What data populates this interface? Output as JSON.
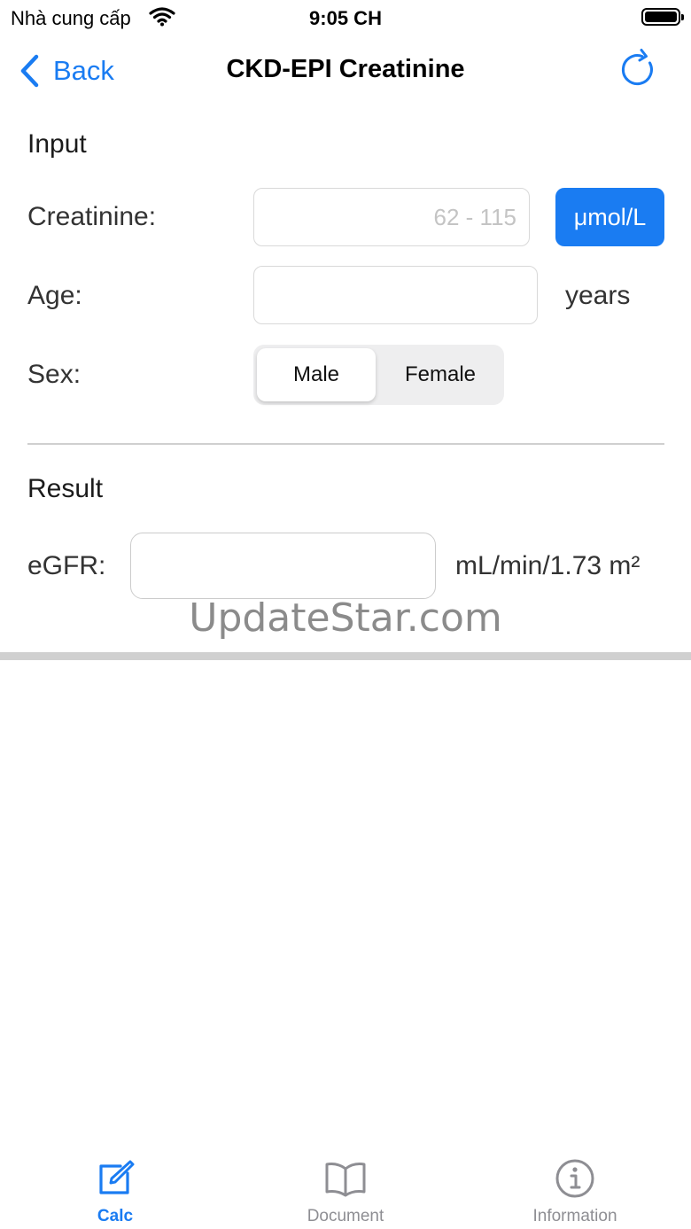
{
  "status_bar": {
    "carrier": "Nhà cung cấp",
    "time": "9:05 CH",
    "battery_level": 1.0
  },
  "nav": {
    "back_label": "Back",
    "title": "CKD-EPI Creatinine",
    "refresh_icon": "refresh-icon"
  },
  "input_section": {
    "heading": "Input",
    "creatinine": {
      "label": "Creatinine:",
      "value": "",
      "placeholder": "62 - 115",
      "unit_button": "μmol/L"
    },
    "age": {
      "label": "Age:",
      "value": "",
      "placeholder": "",
      "unit": "years"
    },
    "sex": {
      "label": "Sex:",
      "options": [
        "Male",
        "Female"
      ],
      "selected": "Male"
    }
  },
  "result_section": {
    "heading": "Result",
    "egfr": {
      "label": "eGFR:",
      "value": "",
      "unit": "mL/min/1.73 m²"
    }
  },
  "watermark": "UpdateStar.com",
  "tab_bar": {
    "tabs": [
      {
        "label": "Calc",
        "icon": "edit-icon",
        "active": true
      },
      {
        "label": "Document",
        "icon": "book-icon",
        "active": false
      },
      {
        "label": "Information",
        "icon": "info-icon",
        "active": false
      }
    ]
  },
  "colors": {
    "accent": "#1a7cf2",
    "inactive_tab": "#8e8e93",
    "divider": "#cfcfcf"
  }
}
